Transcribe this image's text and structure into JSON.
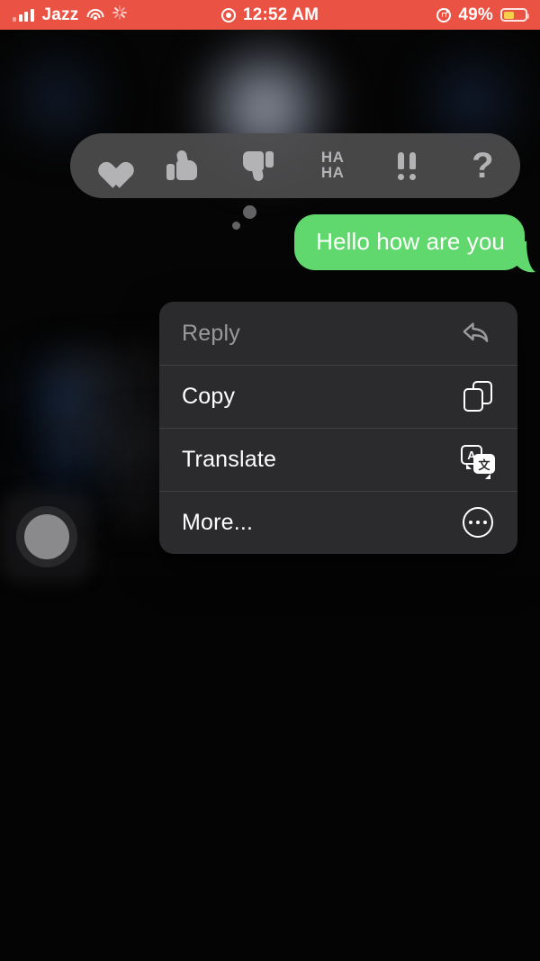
{
  "status_bar": {
    "carrier": "Jazz",
    "time": "12:52 AM",
    "battery_percent": "49%",
    "signal_icon": "cellular-signal-icon",
    "wifi_icon": "wifi-icon",
    "activity_icon": "activity-spinner-icon",
    "recording_icon": "location-recording-icon",
    "orientation_lock_icon": "rotation-lock-icon",
    "battery_icon": "battery-low-power-icon",
    "background_color": "#ea5244",
    "battery_fill_color": "#f5cf4a"
  },
  "tapback_bar": {
    "reactions": [
      {
        "name": "heart",
        "glyph": "♥"
      },
      {
        "name": "thumbs-up",
        "glyph": "👍"
      },
      {
        "name": "thumbs-down",
        "glyph": "👎"
      },
      {
        "name": "haha",
        "line1": "HA",
        "line2": "HA"
      },
      {
        "name": "exclamation",
        "glyph": "!!"
      },
      {
        "name": "question",
        "glyph": "?"
      }
    ],
    "background_color": "#4c4c4e"
  },
  "message": {
    "text": "Hello how are you",
    "bubble_color": "#61d86d",
    "text_color": "#ffffff",
    "alignment": "outgoing-right"
  },
  "context_menu": {
    "items": [
      {
        "label": "Reply",
        "icon": "reply-arrow-icon",
        "dimmed": true
      },
      {
        "label": "Copy",
        "icon": "copy-pages-icon",
        "dimmed": false
      },
      {
        "label": "Translate",
        "icon": "translate-icon",
        "dimmed": false
      },
      {
        "label": "More...",
        "icon": "more-ellipsis-icon",
        "dimmed": false
      }
    ],
    "translate_icon_letters": {
      "source": "A",
      "target": "文"
    },
    "background_color": "#2b2b2d"
  },
  "assistive_touch": {
    "name": "assistive-touch-button"
  }
}
